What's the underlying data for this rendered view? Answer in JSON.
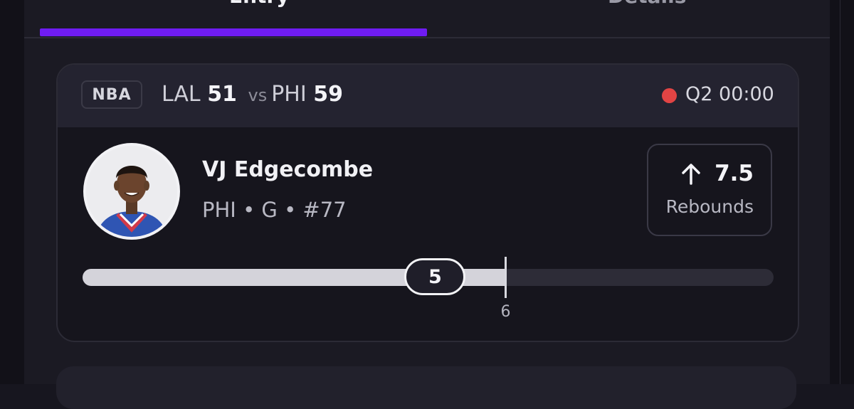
{
  "tabs": [
    {
      "label": "Entry",
      "active": true
    },
    {
      "label": "Details",
      "active": false
    }
  ],
  "colors": {
    "accent": "#6f1cf2",
    "live": "#e24444"
  },
  "game": {
    "league": "NBA",
    "away_team": "LAL",
    "away_score": "51",
    "vs": "vs",
    "home_team": "PHI",
    "home_score": "59",
    "status": "live",
    "clock": "Q2 00:00"
  },
  "player": {
    "name": "VJ Edgecombe",
    "meta": "PHI • G • #77",
    "avatar_icon": "player-headshot"
  },
  "prop": {
    "direction_icon": "arrow-up-icon",
    "line": "7.5",
    "stat": "Rebounds"
  },
  "progress": {
    "current": 5,
    "current_label": "5",
    "target": 6,
    "target_label": "6",
    "max": 9.8
  }
}
